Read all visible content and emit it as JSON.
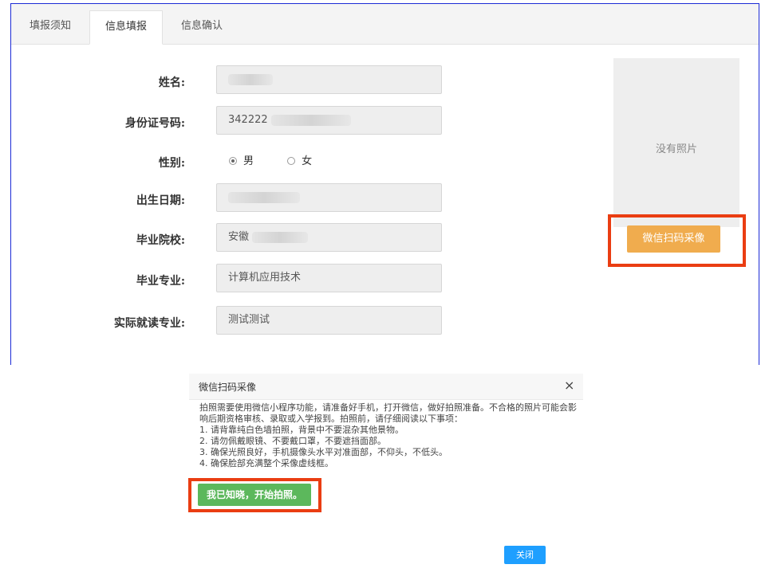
{
  "tabs": [
    {
      "label": "填报须知"
    },
    {
      "label": "信息填报"
    },
    {
      "label": "信息确认"
    }
  ],
  "form": {
    "name_label": "姓名:",
    "name_value": "",
    "id_label": "身份证号码:",
    "id_value": "342222",
    "gender_label": "性别:",
    "gender_options": [
      "男",
      "女"
    ],
    "gender_selected": "男",
    "birth_label": "出生日期:",
    "birth_value": "",
    "school_label": "毕业院校:",
    "school_value": "安徽",
    "major_label": "毕业专业:",
    "major_value": "计算机应用技术",
    "actual_major_label": "实际就读专业:",
    "actual_major_value": "测试测试"
  },
  "photo": {
    "empty_text": "没有照片",
    "scan_button": "微信扫码采像"
  },
  "dialog": {
    "title": "微信扫码采像",
    "close_icon": "×",
    "intro": "拍照需要使用微信小程序功能，请准备好手机，打开微信，做好拍照准备。不合格的照片可能会影响后期资格审核、录取或入学报到。拍照前，请仔细阅读以下事项：",
    "items": [
      "1. 请背靠纯白色墙拍照，背景中不要混杂其他景物。",
      "2. 请勿佩戴眼镜、不要戴口罩，不要遮挡面部。",
      "3. 确保光照良好，手机摄像头水平对准面部，不仰头，不低头。",
      "4. 确保脸部充满整个采像虚线框。"
    ],
    "start_button": "我已知晓，开始拍照。",
    "close_button": "关闭"
  },
  "colors": {
    "accent_orange": "#f0ac4e",
    "accent_green": "#5cb85c",
    "accent_blue": "#1e9fff",
    "highlight_red": "#ea3d12",
    "panel_border": "#1c2bd6"
  }
}
